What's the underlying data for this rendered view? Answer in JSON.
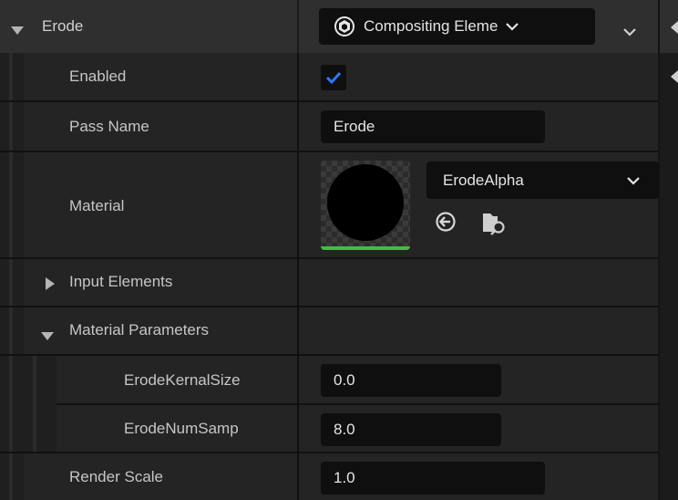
{
  "header": {
    "title": "Erode",
    "type_combo_label": "Compositing Eleme",
    "expand_icon": "triangle-down-icon"
  },
  "rows": {
    "enabled": {
      "label": "Enabled",
      "checked": true
    },
    "pass_name": {
      "label": "Pass Name",
      "value": "Erode"
    },
    "material": {
      "label": "Material",
      "asset_name": "ErodeAlpha",
      "browse_icon": "use-selected-icon",
      "find_icon": "browse-asset-icon"
    },
    "input_elements": {
      "label": "Input Elements",
      "expanded": false
    },
    "material_parameters": {
      "label": "Material Parameters",
      "expanded": true
    },
    "erode_kernal_size": {
      "label": "ErodeKernalSize",
      "value": "0.0"
    },
    "erode_num_samples": {
      "label": "ErodeNumSamp",
      "value": "8.0"
    },
    "render_scale": {
      "label": "Render Scale",
      "value": "1.0"
    }
  },
  "colors": {
    "accent_check": "#2979ff",
    "thumbnail_underline": "#3fbf3f"
  }
}
